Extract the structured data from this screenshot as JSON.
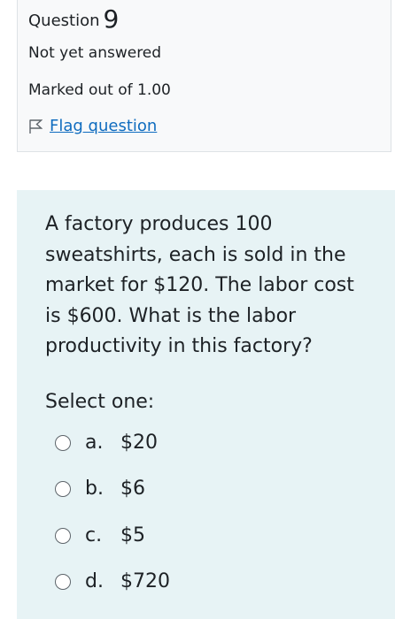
{
  "info": {
    "question_word": "Question",
    "question_number": "9",
    "state": "Not yet answered",
    "grade": "Marked out of 1.00",
    "flag_label": "Flag question"
  },
  "question": {
    "text": "A factory produces 100 sweatshirts, each is sold in the market for $120. The labor cost is $600. What is the labor productivity in this factory?",
    "prompt": "Select one:",
    "options": [
      {
        "letter": "a.",
        "label": "$20"
      },
      {
        "letter": "b.",
        "label": "$6"
      },
      {
        "letter": "c.",
        "label": "$5"
      },
      {
        "letter": "d.",
        "label": "$720"
      }
    ]
  },
  "colors": {
    "link": "#0f6cbf",
    "content_bg": "#e7f3f5",
    "info_bg": "#f8f9fa"
  }
}
